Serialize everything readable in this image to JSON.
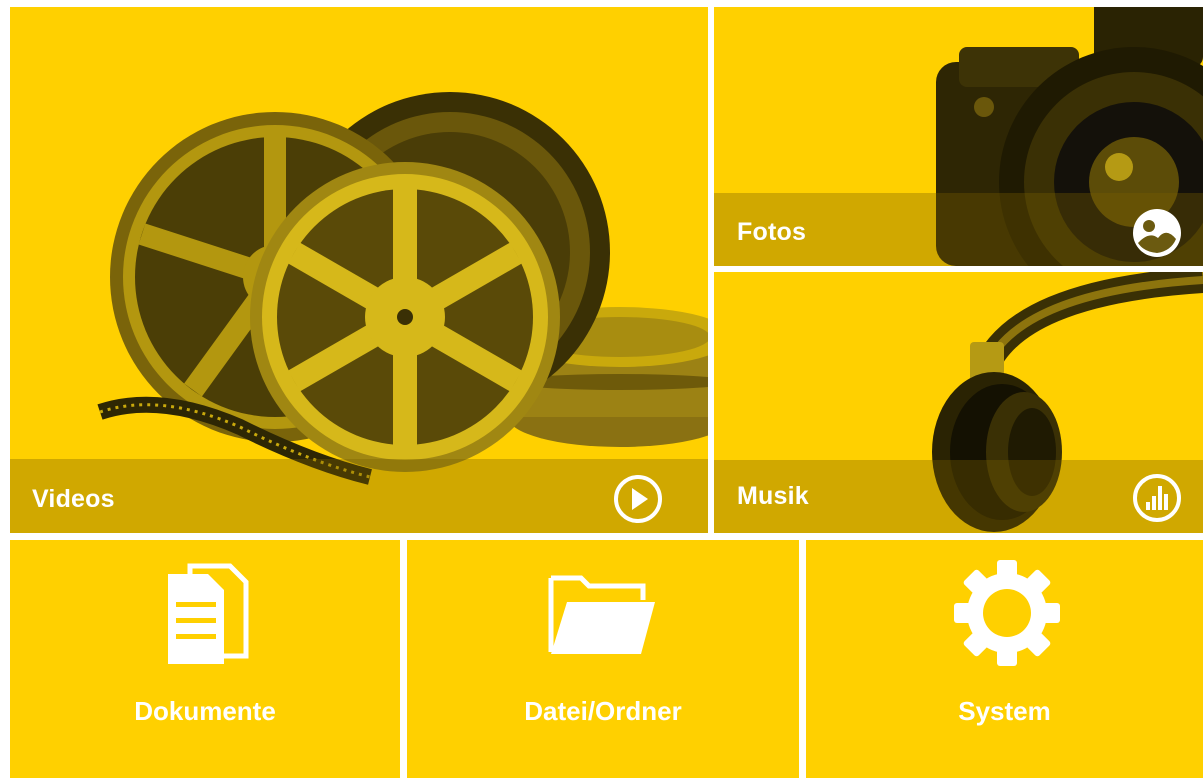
{
  "theme": {
    "accent": "#FFD000",
    "label_color": "#FFFFFF"
  },
  "tiles": {
    "videos": {
      "label": "Videos",
      "icon": "play-circle-icon"
    },
    "photos": {
      "label": "Fotos",
      "icon": "photos-icon"
    },
    "music": {
      "label": "Musik",
      "icon": "equalizer-icon"
    },
    "documents": {
      "label": "Dokumente",
      "icon": "documents-icon"
    },
    "files": {
      "label": "Datei/Ordner",
      "icon": "folder-icon"
    },
    "system": {
      "label": "System",
      "icon": "gear-icon"
    }
  }
}
